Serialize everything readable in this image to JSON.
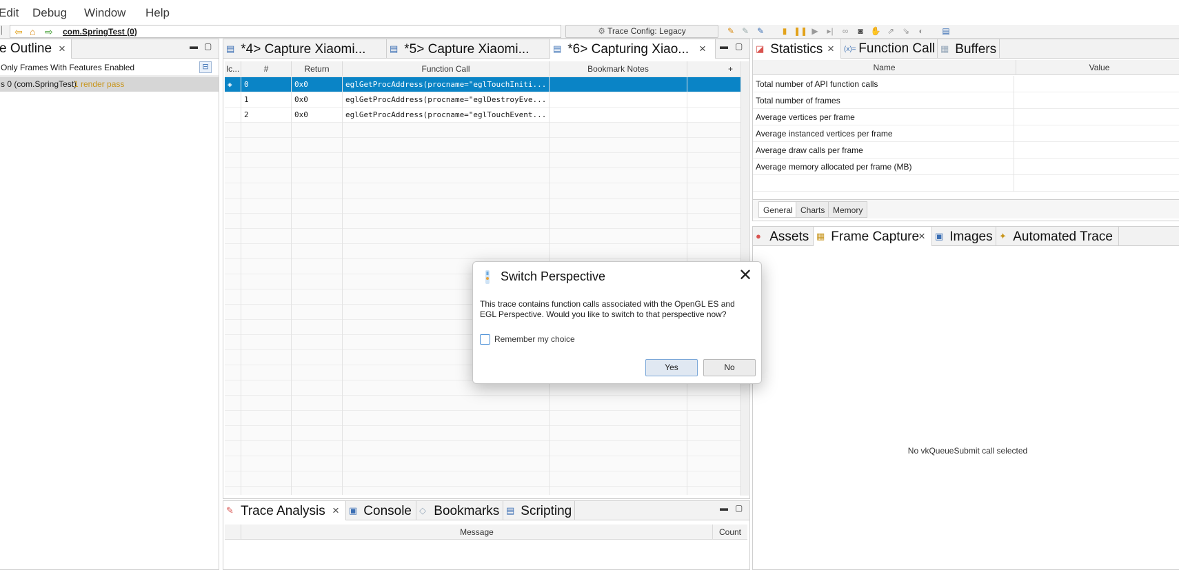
{
  "menu": {
    "items": [
      "Edit",
      "Debug",
      "Window",
      "Help"
    ]
  },
  "toolbar": {
    "breadcrumb_app": "com.SpringTest (0)",
    "trace_config": "Trace Config: Legacy"
  },
  "left_panel": {
    "tab_label": "e Outline",
    "filter_label": "Only Frames With Features Enabled",
    "tree_item": {
      "label": "s 0 (com.SpringTest)",
      "badge": "1 render pass"
    }
  },
  "center_panel": {
    "tabs": [
      {
        "label": "*4> Capture Xiaomi..."
      },
      {
        "label": "*5> Capture Xiaomi..."
      },
      {
        "label": "*6> Capturing Xiao..."
      }
    ],
    "columns": [
      "Ic...",
      "#",
      "Return",
      "Function Call",
      "Bookmark Notes"
    ],
    "rows": [
      {
        "index": "0",
        "return": "0x0",
        "call": "eglGetProcAddress(procname=\"eglTouchIniti..."
      },
      {
        "index": "1",
        "return": "0x0",
        "call": "eglGetProcAddress(procname=\"eglDestroyEve..."
      },
      {
        "index": "2",
        "return": "0x0",
        "call": "eglGetProcAddress(procname=\"eglTouchEvent..."
      }
    ],
    "add_column": "+"
  },
  "bottom_panel": {
    "tabs": [
      {
        "label": "Trace Analysis"
      },
      {
        "label": "Console"
      },
      {
        "label": "Bookmarks"
      },
      {
        "label": "Scripting"
      }
    ],
    "columns": [
      "Message",
      "Count"
    ]
  },
  "right_top_panel": {
    "tabs": [
      {
        "label": "Statistics"
      },
      {
        "label": "Function Call"
      },
      {
        "label": "Buffers"
      }
    ],
    "columns": [
      "Name",
      "Value"
    ],
    "stats": [
      "Total number of API function calls",
      "Total number of frames",
      "Average vertices per frame",
      "Average instanced vertices per frame",
      "Average draw calls per frame",
      "Average memory allocated per frame (MB)"
    ],
    "subtabs": [
      "General",
      "Charts",
      "Memory"
    ]
  },
  "right_bottom_panel": {
    "tabs": [
      {
        "label": "Assets"
      },
      {
        "label": "Frame Capture"
      },
      {
        "label": "Images"
      },
      {
        "label": "Automated Trace"
      }
    ],
    "empty_message": "No vkQueueSubmit call selected"
  },
  "dialog": {
    "title": "Switch Perspective",
    "message": "This trace contains function calls associated with the OpenGL ES and EGL Perspective. Would you like to switch to that perspective now?",
    "remember_label": "Remember my choice",
    "yes_label": "Yes",
    "no_label": "No"
  },
  "colors": {
    "selection": "#0a84c6",
    "badge": "#c8961e",
    "dialog_accent": "#4a8fd6"
  }
}
